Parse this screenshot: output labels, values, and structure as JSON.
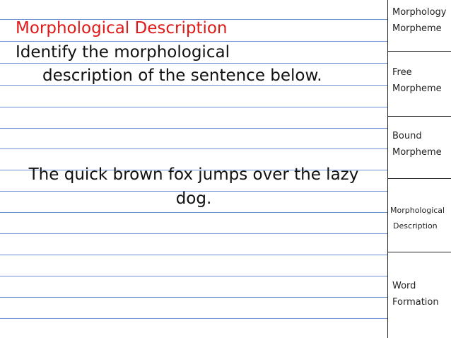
{
  "main": {
    "heading": "Morphological  Description",
    "instruction_line1": "Identify the morphological",
    "instruction_line2": "description of the sentence below.",
    "sentence": "The quick brown fox jumps over the lazy dog."
  },
  "tabs": [
    {
      "line1": "Morphology",
      "line2": "Morpheme"
    },
    {
      "line1": "Free",
      "line2": "Morpheme"
    },
    {
      "line1": "Bound",
      "line2": "Morpheme"
    },
    {
      "line1": "Morphological",
      "line2": "Description"
    },
    {
      "line1": "Word",
      "line2": "Formation"
    }
  ],
  "colors": {
    "heading": "#e01818",
    "rule": "#6f8fd6",
    "divider": "#222222"
  }
}
